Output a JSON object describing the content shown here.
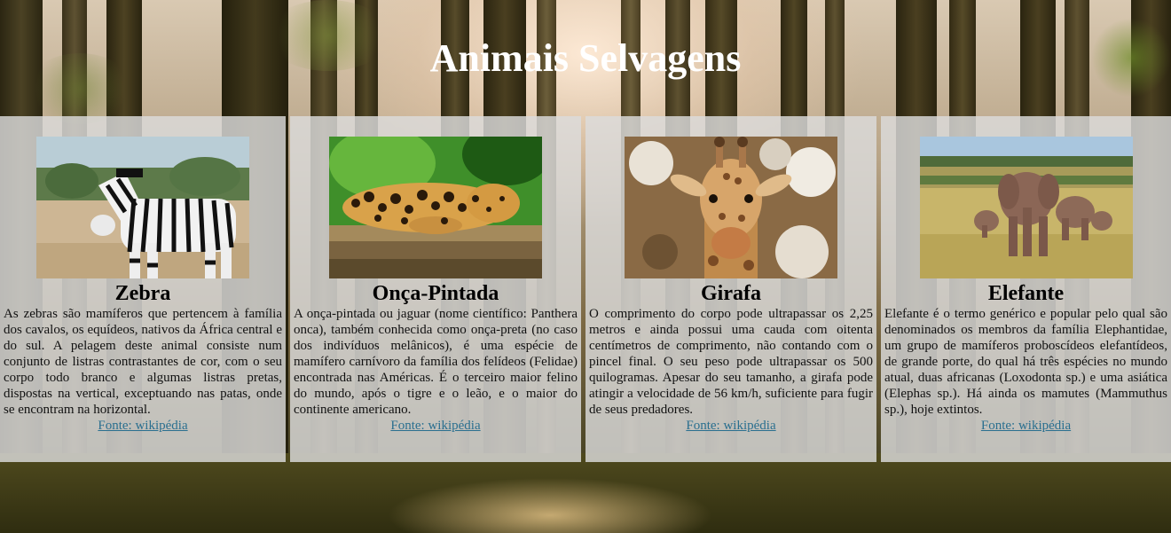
{
  "page": {
    "title": "Animais Selvagens"
  },
  "cards": [
    {
      "name": "Zebra",
      "image_icon": "zebra-photo",
      "description": "As zebras são mamíferos que pertencem à família dos cavalos, os equídeos, nativos da África central e do sul. A pelagem deste animal consiste num conjunto de listras contrastantes de cor, com o seu corpo todo branco e algumas listras pretas, dispostas na vertical, exceptuando nas patas, onde se encontram na horizontal.",
      "source_label": "Fonte: wikipédia"
    },
    {
      "name": "Onça-Pintada",
      "image_icon": "jaguar-photo",
      "description": "A onça-pintada ou jaguar (nome científico: Panthera onca), também conhecida como onça-preta (no caso dos indivíduos melânicos), é uma espécie de mamífero carnívoro da família dos felídeos (Felidae) encontrada nas Américas. É o terceiro maior felino do mundo, após o tigre e o leão, e o maior do continente americano.",
      "source_label": "Fonte: wikipédia"
    },
    {
      "name": "Girafa",
      "image_icon": "giraffe-photo",
      "description": "O comprimento do corpo pode ultrapassar os 2,25 metros e ainda possui uma cauda com oitenta centímetros de comprimento, não contando com o pincel final. O seu peso pode ultrapassar os 500 quilogramas. Apesar do seu tamanho, a girafa pode atingir a velocidade de 56 km/h, suficiente para fugir de seus predadores.",
      "source_label": "Fonte: wikipédia"
    },
    {
      "name": "Elefante",
      "image_icon": "elephant-photo",
      "description": "Elefante é o termo genérico e popular pelo qual são denominados os membros da família Elephantidae, um grupo de mamíferos proboscídeos elefantídeos, de grande porte, do qual há três espécies no mundo atual, duas africanas (Loxodonta sp.) e uma asiática (Elephas sp.). Há ainda os mamutes (Mammuthus sp.), hoje extintos.",
      "source_label": "Fonte: wikipédia"
    }
  ],
  "colors": {
    "card_bg": "#dcdcdc",
    "link": "#2a6f8f",
    "title": "#ffffff"
  }
}
